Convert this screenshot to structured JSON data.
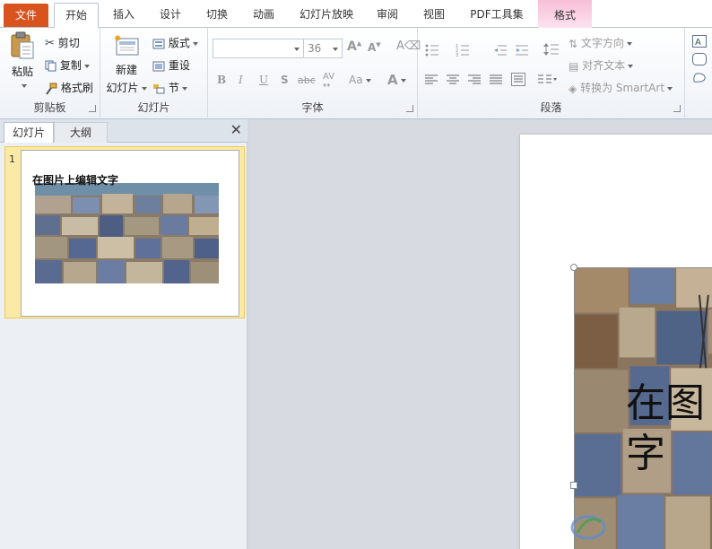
{
  "tabs": {
    "file": "文件",
    "home": "开始",
    "insert": "插入",
    "design": "设计",
    "transitions": "切换",
    "animations": "动画",
    "slideshow": "幻灯片放映",
    "review": "审阅",
    "view": "视图",
    "pdf": "PDF工具集",
    "format": "格式"
  },
  "clipboard": {
    "paste": "粘贴",
    "cut": "剪切",
    "copy": "复制",
    "format_painter": "格式刷",
    "label": "剪贴板"
  },
  "slides_group": {
    "new_slide_line1": "新建",
    "new_slide_line2": "幻灯片",
    "layout": "版式",
    "reset": "重设",
    "section": "节",
    "label": "幻灯片"
  },
  "font_group": {
    "font_name": "",
    "font_size": "36",
    "label": "字体"
  },
  "paragraph_group": {
    "text_direction": "文字方向",
    "align_text": "对齐文本",
    "convert_smartart": "转换为 SmartArt",
    "label": "段落"
  },
  "panel": {
    "tab_slides": "幻灯片",
    "tab_outline": "大纲",
    "close": "✕",
    "slide_number": "1",
    "thumb_text": "在图片上编辑文字"
  },
  "slide": {
    "text_line1": "在图",
    "text_line2": "字"
  },
  "colors": {
    "file_tab": "#d9531e",
    "context_tab": "#f8bfd8",
    "thumb_highlight": "#fbe9a6"
  }
}
